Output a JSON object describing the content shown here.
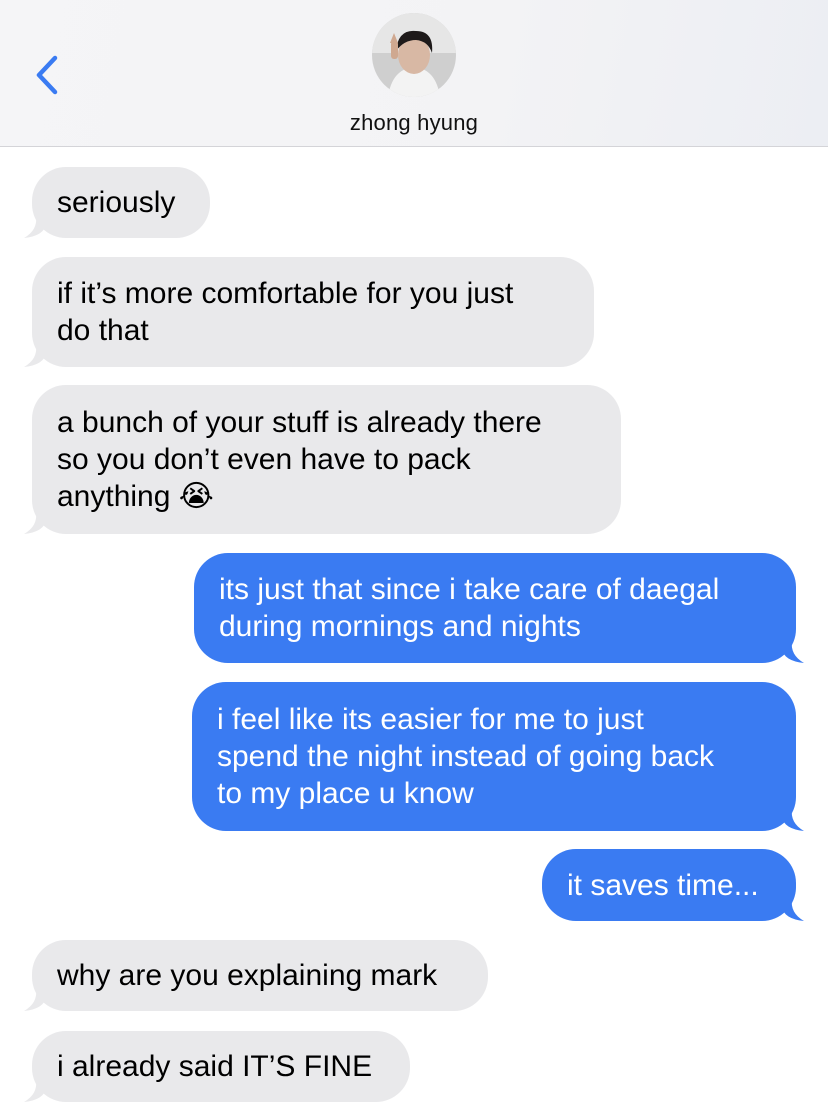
{
  "header": {
    "back_icon": "chevron-left-icon",
    "contact_name": "zhong hyung",
    "accent": "#3a7bf2"
  },
  "messages": [
    {
      "from": "contact",
      "text": "seriously"
    },
    {
      "from": "contact",
      "text": "if it’s more comfortable for you just\ndo that"
    },
    {
      "from": "contact",
      "text": "a bunch of your stuff is already there\nso you don’t even have to pack\nanything 😭"
    },
    {
      "from": "me",
      "text": "its just that since i take care of daegal\nduring mornings and nights"
    },
    {
      "from": "me",
      "text": "i feel like its easier for me to just\nspend the night instead of going back\nto my place u know"
    },
    {
      "from": "me",
      "text": "it saves time..."
    },
    {
      "from": "contact",
      "text": "why are you explaining mark"
    },
    {
      "from": "contact",
      "text": "i already said IT’S FINE"
    }
  ],
  "colors": {
    "received_bubble": "#e9e9eb",
    "sent_bubble": "#3a7bf2"
  }
}
